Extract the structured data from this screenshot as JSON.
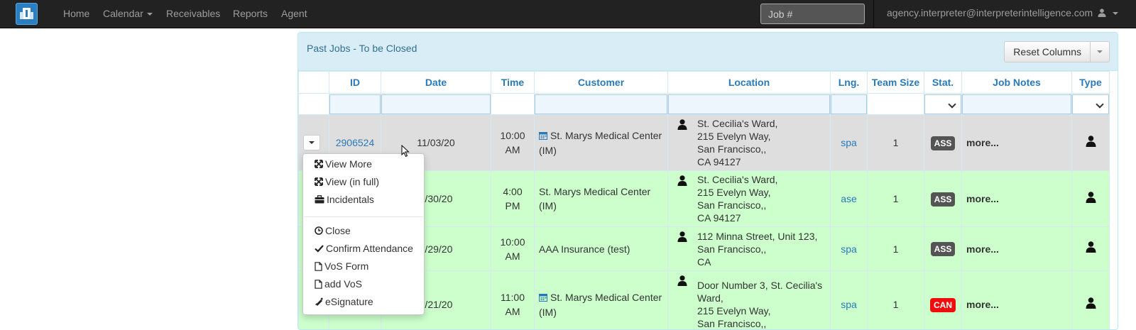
{
  "nav": {
    "items": [
      {
        "label": "Home"
      },
      {
        "label": "Calendar"
      },
      {
        "label": "Receivables"
      },
      {
        "label": "Reports"
      },
      {
        "label": "Agent"
      }
    ],
    "search_placeholder": "Job #",
    "user_email": "agency.interpreter@interpreterintelligence.com"
  },
  "panel": {
    "title": "Past Jobs - To be Closed",
    "reset_label": "Reset Columns"
  },
  "table": {
    "headers": [
      "",
      "ID",
      "Date",
      "Time",
      "Customer",
      "Location",
      "Lng.",
      "Team Size",
      "Stat.",
      "Job Notes",
      "Type"
    ],
    "rows": [
      {
        "id": "2906524",
        "date": "11/03/20",
        "time1": "10:00",
        "time2": "AM",
        "customer1": "St. Marys Medical Center",
        "customer2": "(IM)",
        "customer_icon": "calendar-icon",
        "loc1": "St. Cecilia's Ward,",
        "loc2": "215 Evelyn Way,",
        "loc3": "San Francisco,,",
        "loc4": "CA 94127",
        "lng": "spa",
        "team": "1",
        "status": "ASS",
        "notes": "more..."
      },
      {
        "id": "",
        "date": "0/30/20",
        "time1": "4:00",
        "time2": "PM",
        "customer1": "St. Marys Medical Center",
        "customer2": "(IM)",
        "loc1": "St. Cecilia's Ward,",
        "loc2": "215 Evelyn Way,",
        "loc3": "San Francisco,,",
        "loc4": "CA 94127",
        "lng": "ase",
        "team": "1",
        "status": "ASS",
        "notes": "more..."
      },
      {
        "id": "",
        "date": "0/29/20",
        "time1": "10:00",
        "time2": "AM",
        "customer1": "AAA Insurance (test)",
        "customer2": "",
        "loc1": "112 Minna Street, Unit 123,",
        "loc2": "San Francisco,,",
        "loc3": "CA",
        "loc4": "",
        "lng": "spa",
        "team": "1",
        "status": "ASS",
        "notes": "more..."
      },
      {
        "id": "",
        "date": "0/21/20",
        "time1": "11:00",
        "time2": "AM",
        "customer1": "St. Marys Medical Center",
        "customer2": "(IM)",
        "customer_icon": "calendar-icon",
        "loc1": "Door Number 3, St. Cecilia's",
        "loc2": "Ward,",
        "loc3": "215 Evelyn Way,",
        "loc4": "San Francisco,,",
        "lng": "spa",
        "team": "1",
        "status": "CAN",
        "notes": "more..."
      }
    ]
  },
  "menu": {
    "items": [
      {
        "label": "View More",
        "icon": "expand-icon"
      },
      {
        "label": "View (in full)",
        "icon": "expand-icon"
      },
      {
        "label": "Incidentals",
        "icon": "briefcase-icon"
      },
      {
        "label": "Close",
        "icon": "clock-icon"
      },
      {
        "label": "Confirm Attendance",
        "icon": "check-icon"
      },
      {
        "label": "VoS Form",
        "icon": "file-icon"
      },
      {
        "label": "add VoS",
        "icon": "file-icon"
      },
      {
        "label": "eSignature",
        "icon": "pencil-icon"
      }
    ]
  },
  "colors": {
    "navbar": "#222222",
    "row_highlight": "#dedede",
    "row_green": "#ccffcc",
    "link": "#2a7ab8",
    "badge_ass": "#545454",
    "badge_can": "#f00c0c"
  }
}
